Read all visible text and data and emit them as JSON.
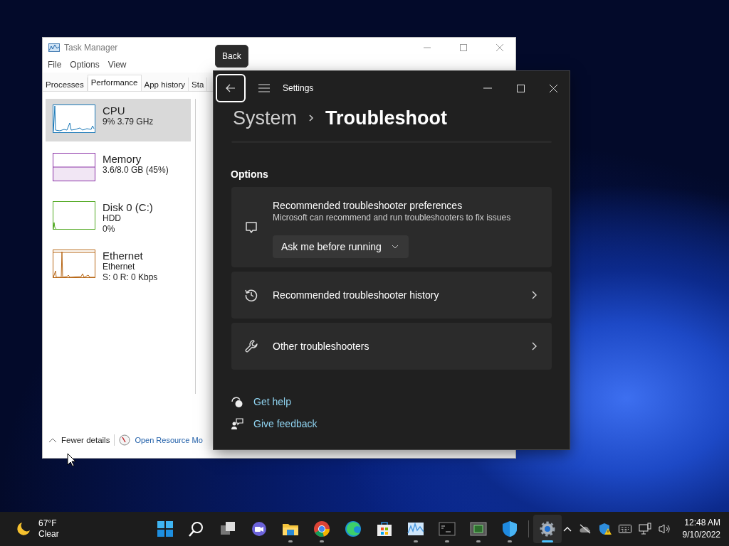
{
  "task_manager": {
    "title": "Task Manager",
    "menu": [
      "File",
      "Options",
      "View"
    ],
    "tabs": [
      {
        "label": "Processes",
        "selected": false
      },
      {
        "label": "Performance",
        "selected": true
      },
      {
        "label": "App history",
        "selected": false
      },
      {
        "label": "Sta",
        "selected": false
      }
    ],
    "resources": [
      {
        "kind": "cpu",
        "name": "CPU",
        "details": [
          "9% 3.79 GHz"
        ],
        "color": "#1b79b8",
        "selected": true
      },
      {
        "kind": "memory",
        "name": "Memory",
        "details": [
          "3.6/8.0 GB (45%)"
        ],
        "color": "#8b32a6",
        "selected": false
      },
      {
        "kind": "disk",
        "name": "Disk 0 (C:)",
        "details": [
          "HDD",
          "0%"
        ],
        "color": "#4fa81f",
        "selected": false
      },
      {
        "kind": "network",
        "name": "Ethernet",
        "details": [
          "Ethernet",
          "S: 0 R: 0 Kbps"
        ],
        "color": "#b86818",
        "selected": false
      }
    ],
    "footer": {
      "toggle": "Fewer details",
      "link": "Open Resource Mo"
    }
  },
  "tooltip": "Back",
  "settings": {
    "title": "Settings",
    "breadcrumb": [
      "System",
      "Troubleshoot"
    ],
    "section": "Options",
    "cards": [
      {
        "kind": "dropdown",
        "title": "Recommended troubleshooter preferences",
        "subtitle": "Microsoft can recommend and run troubleshooters to fix issues",
        "value": "Ask me before running"
      },
      {
        "kind": "link",
        "title": "Recommended troubleshooter history"
      },
      {
        "kind": "link",
        "title": "Other troubleshooters"
      }
    ],
    "links": [
      "Get help",
      "Give feedback"
    ]
  },
  "taskbar": {
    "weather": {
      "temperature": "67°F",
      "condition": "Clear"
    },
    "apps": [
      {
        "running": false,
        "selected": false
      },
      {
        "running": false,
        "selected": false
      },
      {
        "running": false,
        "selected": false
      },
      {
        "running": false,
        "selected": false
      },
      {
        "running": true,
        "selected": false
      },
      {
        "running": true,
        "selected": false
      },
      {
        "running": false,
        "selected": false
      },
      {
        "running": false,
        "selected": false
      },
      {
        "running": true,
        "selected": false
      },
      {
        "running": true,
        "selected": false
      },
      {
        "running": true,
        "selected": false
      },
      {
        "running": true,
        "selected": false
      },
      {
        "running": true,
        "selected": true
      }
    ],
    "clock": {
      "time": "12:48 AM",
      "date": "9/10/2022"
    }
  }
}
